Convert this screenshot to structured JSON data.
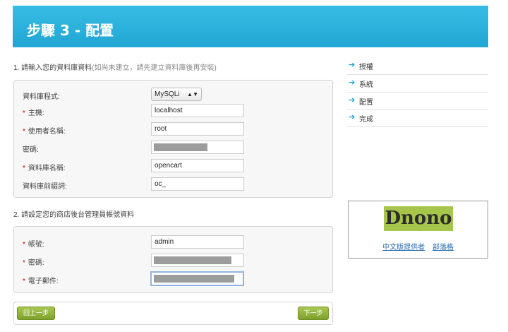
{
  "header": {
    "title": "步驟 3 - 配置"
  },
  "db_section": {
    "title": "1. 請輸入您的資料庫資料",
    "note": "(如尚未建立，請先建立資料庫後再安裝)",
    "fields": {
      "driver": {
        "label": "資料庫程式:",
        "value": "MySQLi",
        "arrow": "▲▼"
      },
      "host": {
        "label": "主機:",
        "value": "localhost"
      },
      "user": {
        "label": "使用者名稱:",
        "value": "root"
      },
      "password": {
        "label": "密碼:",
        "value": ""
      },
      "dbname": {
        "label": "資料庫名稱:",
        "value": "opencart"
      },
      "prefix": {
        "label": "資料庫前綴詞:",
        "value": "oc_"
      }
    }
  },
  "admin_section": {
    "title": "2. 請設定您的商店後台管理員帳號資料",
    "fields": {
      "username": {
        "label": "帳號:",
        "value": "admin"
      },
      "password": {
        "label": "密碼:",
        "value": ""
      },
      "email": {
        "label": "電子郵件:",
        "value": ""
      }
    }
  },
  "required_mark": "*",
  "buttons": {
    "back": "回上一步",
    "next": "下一步"
  },
  "steps": [
    {
      "label": "授權"
    },
    {
      "label": "系統"
    },
    {
      "label": "配置"
    },
    {
      "label": "完成"
    }
  ],
  "step_arrow": "➔",
  "sponsor": {
    "logo_text": "Dnono",
    "link1": "中文版提供者",
    "link2": "部落格"
  }
}
